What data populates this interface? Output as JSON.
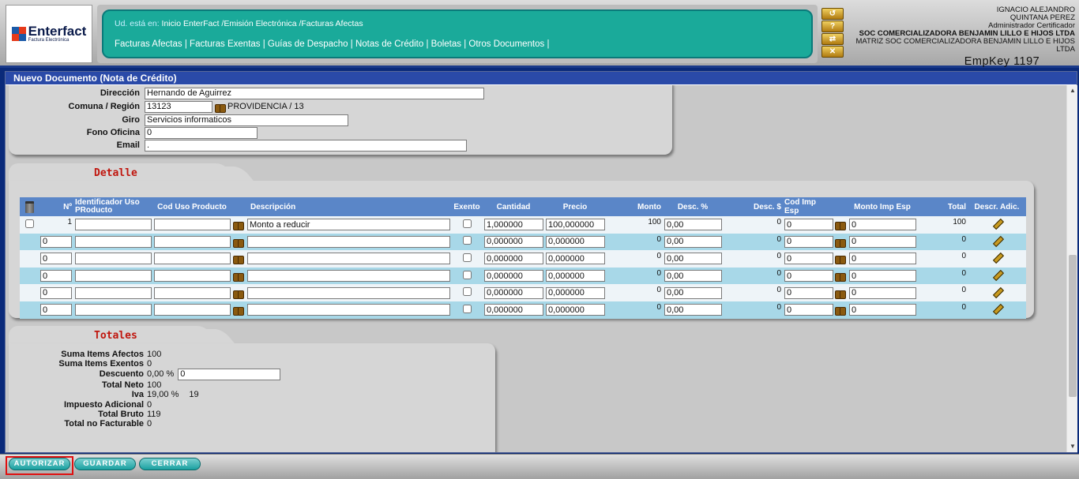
{
  "header": {
    "logo_text": "Enterfact",
    "logo_sub": "Factura Electrónica",
    "breadcrumb_label": "Ud. está en:",
    "breadcrumb_path": "Inicio EnterFact /Emisión Electrónica /Facturas Afectas",
    "nav": [
      "Facturas Afectas",
      "Facturas Exentas",
      "Guías de Despacho",
      "Notas de Crédito",
      "Boletas",
      "Otros Documentos"
    ],
    "nav_sep": " | ",
    "icons": [
      "back-icon",
      "help-icon",
      "refresh-icon",
      "close-icon"
    ]
  },
  "user": {
    "name1": "IGNACIO ALEJANDRO",
    "name2": "QUINTANA PEREZ",
    "role": "Administrador Certificador",
    "company": "SOC COMERCIALIZADORA BENJAMIN LILLO E HIJOS LTDA",
    "matrix": "MATRIZ SOC COMERCIALIZADORA BENJAMIN LILLO E HIJOS LTDA",
    "empkey": "EmpKey 1197"
  },
  "document": {
    "title": "Nuevo Documento (Nota de Crédito)",
    "fields": {
      "direccion_label": "Dirección",
      "direccion_value": "Hernando de Aguirrez",
      "comuna_label": "Comuna / Región",
      "comuna_value": "13123",
      "comuna_text": "PROVIDENCIA / 13",
      "giro_label": "Giro",
      "giro_value": "Servicios informaticos",
      "fono_label": "Fono Oficina",
      "fono_value": "0",
      "email_label": "Email",
      "email_value": "."
    }
  },
  "detalle": {
    "tab_title": "Detalle",
    "columns": [
      "Nº",
      "Identificador Uso PRoducto",
      "Cod Uso Producto",
      "Descripción",
      "Exento",
      "Cantidad",
      "Precio",
      "Monto",
      "Desc. %",
      "Desc. $",
      "Cod Imp Esp",
      "Monto Imp Esp",
      "Total",
      "Descr. Adic."
    ],
    "rows": [
      {
        "n": "1",
        "id": "",
        "cod": "",
        "desc": "Monto a reducir",
        "cant": "1,000000",
        "precio": "100,000000",
        "monto": "100",
        "descp": "0,00",
        "descd": "0",
        "codimp": "0",
        "montoimp": "0",
        "total": "100"
      },
      {
        "n": "0",
        "id": "",
        "cod": "",
        "desc": "",
        "cant": "0,000000",
        "precio": "0,000000",
        "monto": "0",
        "descp": "0,00",
        "descd": "0",
        "codimp": "0",
        "montoimp": "0",
        "total": "0"
      },
      {
        "n": "0",
        "id": "",
        "cod": "",
        "desc": "",
        "cant": "0,000000",
        "precio": "0,000000",
        "monto": "0",
        "descp": "0,00",
        "descd": "0",
        "codimp": "0",
        "montoimp": "0",
        "total": "0"
      },
      {
        "n": "0",
        "id": "",
        "cod": "",
        "desc": "",
        "cant": "0,000000",
        "precio": "0,000000",
        "monto": "0",
        "descp": "0,00",
        "descd": "0",
        "codimp": "0",
        "montoimp": "0",
        "total": "0"
      },
      {
        "n": "0",
        "id": "",
        "cod": "",
        "desc": "",
        "cant": "0,000000",
        "precio": "0,000000",
        "monto": "0",
        "descp": "0,00",
        "descd": "0",
        "codimp": "0",
        "montoimp": "0",
        "total": "0"
      },
      {
        "n": "0",
        "id": "",
        "cod": "",
        "desc": "",
        "cant": "0,000000",
        "precio": "0,000000",
        "monto": "0",
        "descp": "0,00",
        "descd": "0",
        "codimp": "0",
        "montoimp": "0",
        "total": "0"
      }
    ]
  },
  "totales": {
    "tab_title": "Totales",
    "suma_afectos_label": "Suma Items Afectos",
    "suma_afectos": "100",
    "suma_exentos_label": "Suma Items Exentos",
    "suma_exentos": "0",
    "descuento_label": "Descuento",
    "descuento_pct": "0,00 %",
    "descuento_input": "0",
    "neto_label": "Total Neto",
    "neto": "100",
    "iva_label": "Iva",
    "iva_pct": "19,00 %",
    "iva": "19",
    "imp_adicional_label": "Impuesto Adicional",
    "imp_adicional": "0",
    "bruto_label": "Total Bruto",
    "bruto": "119",
    "no_facturable_label": "Total no Facturable",
    "no_facturable": "0"
  },
  "actions": {
    "autorizar": "AUTORIZAR",
    "guardar": "GUARDAR",
    "cerrar": "CERRAR"
  }
}
